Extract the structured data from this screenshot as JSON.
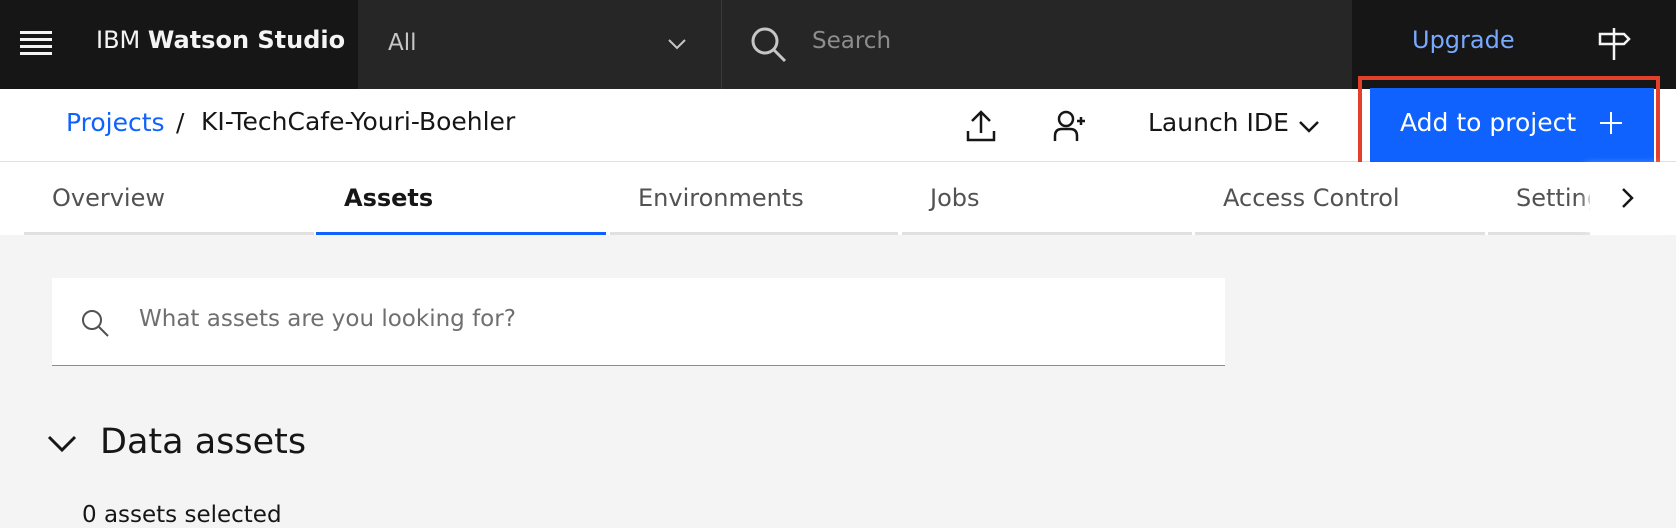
{
  "topbar": {
    "brand_prefix": "IBM ",
    "brand_product": "Watson Studio",
    "scope_value": "All",
    "search_placeholder": "Search",
    "upgrade_label": "Upgrade"
  },
  "project": {
    "breadcrumb_root": "Projects",
    "breadcrumb_separator": "/",
    "name": "KI-TechCafe-Youri-Boehler",
    "launch_ide_label": "Launch IDE",
    "add_to_project_label": "Add to project"
  },
  "tabs": [
    {
      "label": "Overview",
      "active": false
    },
    {
      "label": "Assets",
      "active": true
    },
    {
      "label": "Environments",
      "active": false
    },
    {
      "label": "Jobs",
      "active": false
    },
    {
      "label": "Access Control",
      "active": false
    },
    {
      "label": "Settings",
      "active": false
    }
  ],
  "assets": {
    "search_placeholder": "What assets are you looking for?",
    "section_title": "Data assets",
    "selected_count": "0 assets selected"
  },
  "colors": {
    "accent": "#0f62fe",
    "highlight": "#e3402c",
    "topbar_bg": "#161616",
    "link": "#78a9ff"
  }
}
